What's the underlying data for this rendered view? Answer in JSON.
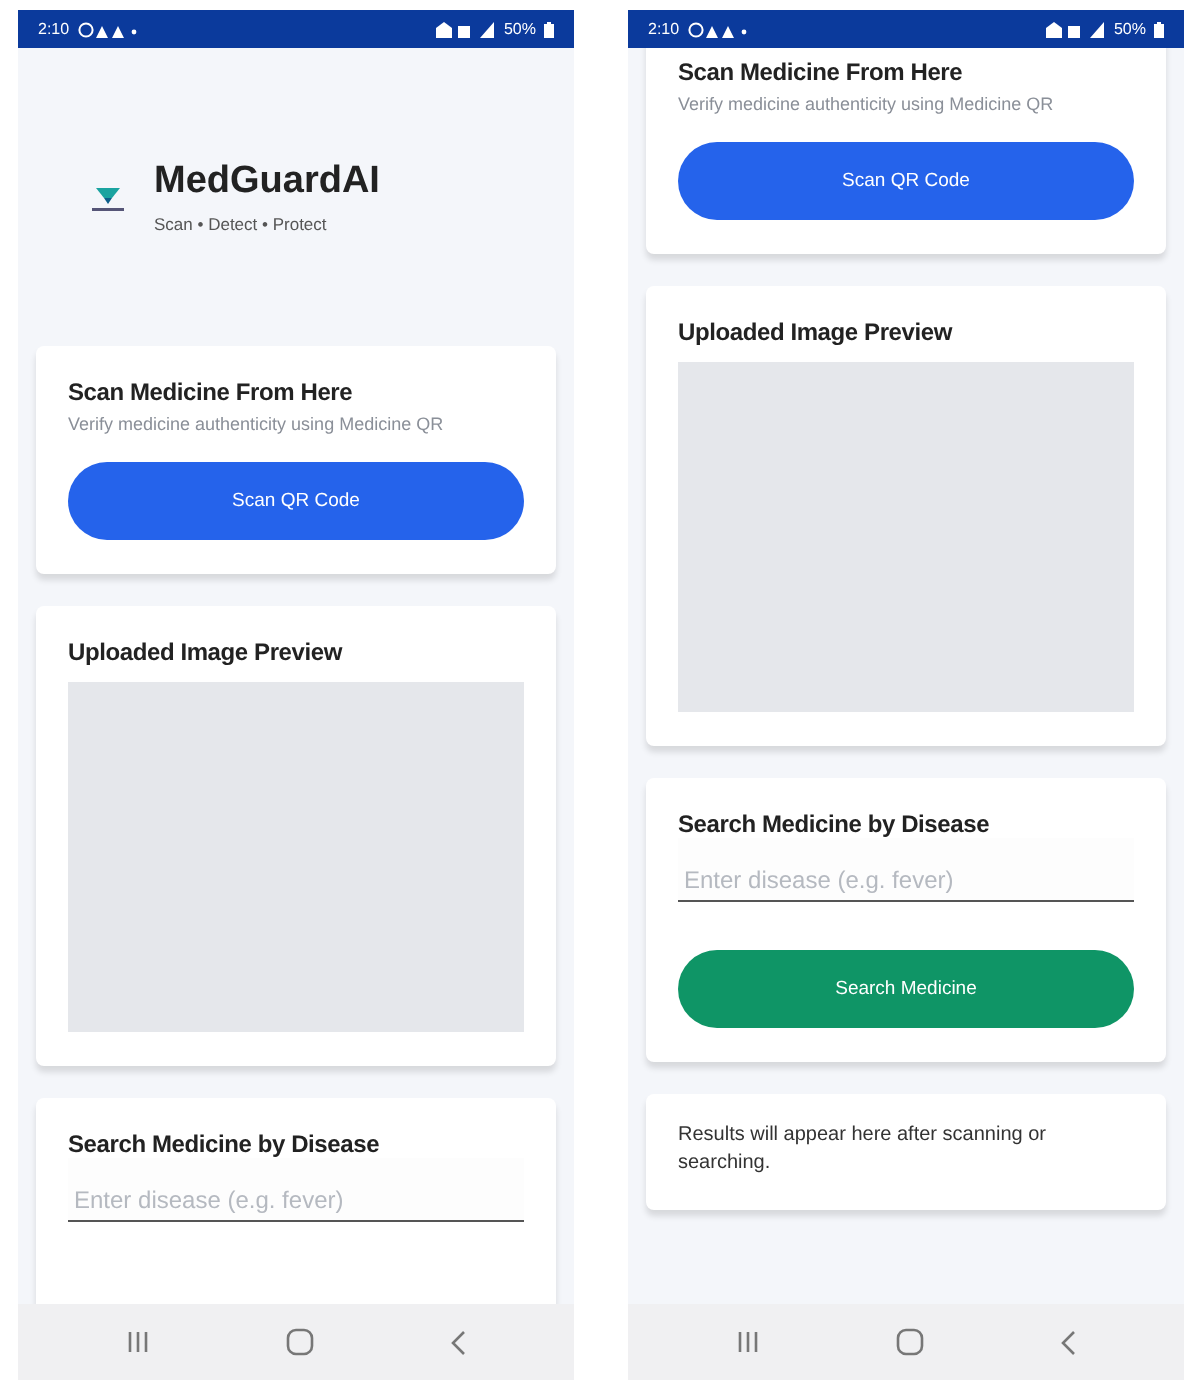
{
  "screens": [
    {
      "status_bar": {
        "time": "2:10",
        "battery": "50%"
      },
      "header": {
        "title": "MedGuardAI",
        "tagline": "Scan • Detect • Protect"
      },
      "cards": [
        {
          "kind": "scan",
          "title": "Scan Medicine From Here",
          "subtitle": "Verify medicine authenticity using Medicine QR",
          "button": "Scan QR Code"
        },
        {
          "kind": "preview",
          "title": "Uploaded Image Preview"
        },
        {
          "kind": "search",
          "title": "Search Medicine by Disease",
          "placeholder": "Enter disease (e.g. fever)"
        }
      ]
    },
    {
      "status_bar": {
        "time": "2:10",
        "battery": "50%"
      },
      "cards": [
        {
          "kind": "scan",
          "title": "Scan Medicine From Here",
          "subtitle": "Verify medicine authenticity using Medicine QR",
          "button": "Scan QR Code"
        },
        {
          "kind": "preview",
          "title": "Uploaded Image Preview"
        },
        {
          "kind": "search",
          "title": "Search Medicine by Disease",
          "placeholder": "Enter disease (e.g. fever)",
          "button": "Search Medicine"
        },
        {
          "kind": "results",
          "text": "Results will appear here after scanning or searching."
        }
      ]
    }
  ]
}
